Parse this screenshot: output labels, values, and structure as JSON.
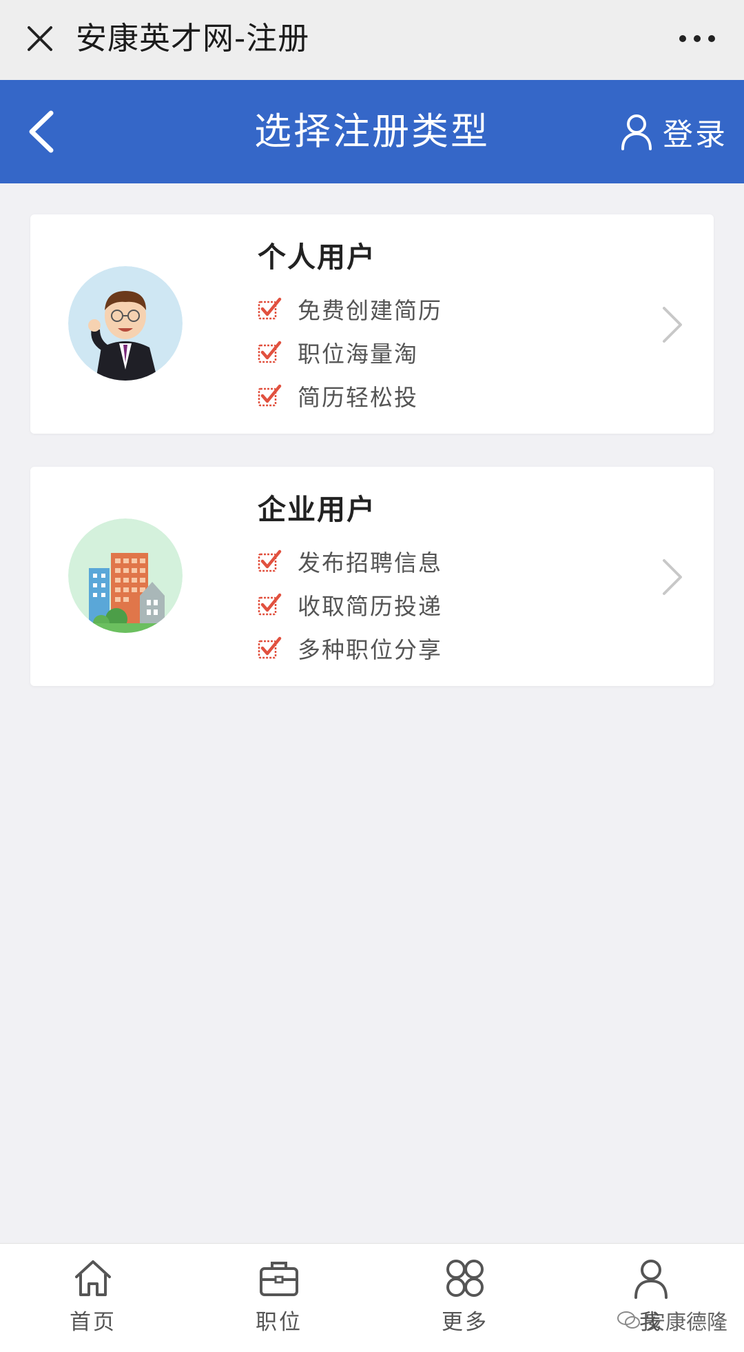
{
  "topbar": {
    "title": "安康英才网-注册"
  },
  "header": {
    "title": "选择注册类型",
    "login_label": "登录"
  },
  "cards": [
    {
      "title": "个人用户",
      "features": [
        "免费创建简历",
        "职位海量淘",
        "简历轻松投"
      ]
    },
    {
      "title": "企业用户",
      "features": [
        "发布招聘信息",
        "收取简历投递",
        "多种职位分享"
      ]
    }
  ],
  "bottom_nav": {
    "items": [
      {
        "label": "首页",
        "icon": "home-icon"
      },
      {
        "label": "职位",
        "icon": "briefcase-icon"
      },
      {
        "label": "更多",
        "icon": "grid-icon"
      },
      {
        "label": "我",
        "icon": "user-icon"
      }
    ]
  },
  "watermark": {
    "text": "安康德隆"
  },
  "colors": {
    "header_bg": "#3567c8",
    "check_red": "#e1513f",
    "page_bg": "#f1f1f4"
  }
}
